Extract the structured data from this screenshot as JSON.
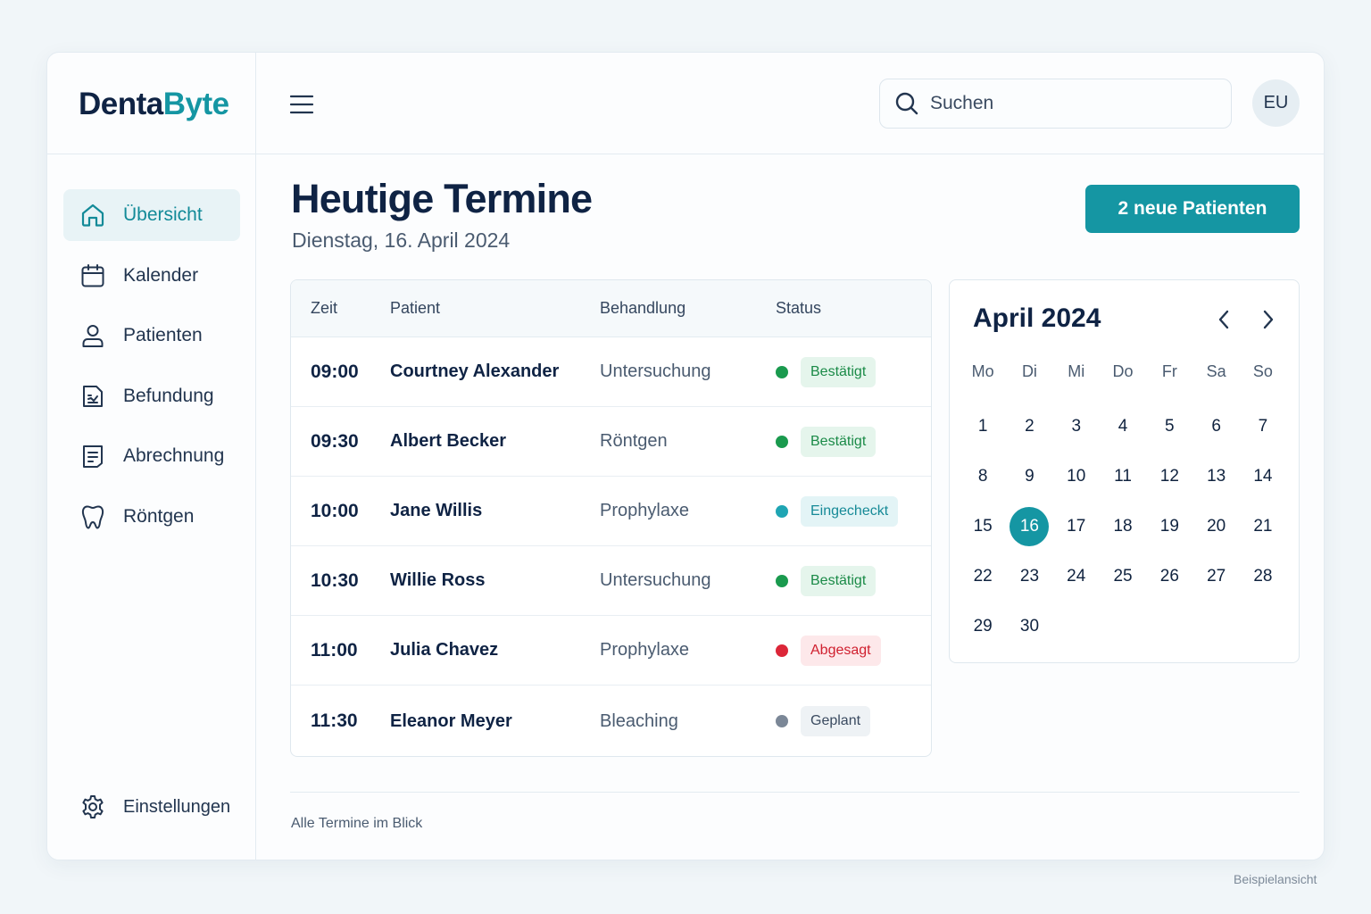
{
  "brand": {
    "part1": "Denta",
    "part2": "Byte"
  },
  "header": {
    "search_placeholder": "Suchen",
    "avatar_initials": "EU"
  },
  "sidebar": {
    "items": [
      {
        "label": "Übersicht",
        "icon": "home-icon",
        "active": true
      },
      {
        "label": "Kalender",
        "icon": "calendar-icon",
        "active": false
      },
      {
        "label": "Patienten",
        "icon": "user-icon",
        "active": false
      },
      {
        "label": "Befundung",
        "icon": "chart-file-icon",
        "active": false
      },
      {
        "label": "Abrechnung",
        "icon": "invoice-icon",
        "active": false
      },
      {
        "label": "Röntgen",
        "icon": "tooth-icon",
        "active": false
      }
    ],
    "settings_label": "Einstellungen"
  },
  "main": {
    "title": "Heutige Termine",
    "date": "Dienstag, 16. April 2024",
    "new_patients_button": "2 neue Patienten",
    "table": {
      "headers": [
        "Zeit",
        "Patient",
        "Behandlung",
        "Status"
      ],
      "rows": [
        {
          "time": "09:00",
          "patient": "Courtney Alexander",
          "treatment": "Untersuchung",
          "status": "Bestätigt"
        },
        {
          "time": "09:30",
          "patient": "Albert Becker",
          "treatment": "Röntgen",
          "status": "Bestätigt"
        },
        {
          "time": "10:00",
          "patient": "Jane Willis",
          "treatment": "Prophylaxe",
          "status": "Eingecheckt"
        },
        {
          "time": "10:30",
          "patient": "Willie Ross",
          "treatment": "Untersuchung",
          "status": "Bestätigt"
        },
        {
          "time": "11:00",
          "patient": "Julia Chavez",
          "treatment": "Prophylaxe",
          "status": "Abgesagt"
        },
        {
          "time": "11:30",
          "patient": "Eleanor Meyer",
          "treatment": "Bleaching",
          "status": "Geplant"
        }
      ]
    },
    "status_colors": {
      "Bestätigt": {
        "dot": "#1a9a4e",
        "bg": "#e5f5ec",
        "text": "#1a8a47"
      },
      "Eingecheckt": {
        "dot": "#1fa5b3",
        "bg": "#e3f4f6",
        "text": "#168a97"
      },
      "Abgesagt": {
        "dot": "#dc2638",
        "bg": "#fde8ea",
        "text": "#d0202f"
      },
      "Geplant": {
        "dot": "#7b8797",
        "bg": "#eef2f5",
        "text": "#3a4a60"
      }
    },
    "footer_text": "Alle Termine im Blick"
  },
  "calendar": {
    "title": "April 2024",
    "weekdays": [
      "Mo",
      "Di",
      "Mi",
      "Do",
      "Fr",
      "Sa",
      "So"
    ],
    "weeks": [
      [
        "1",
        "2",
        "3",
        "4",
        "5",
        "6",
        "7"
      ],
      [
        "8",
        "9",
        "10",
        "11",
        "12",
        "13",
        "14"
      ],
      [
        "15",
        "16",
        "17",
        "18",
        "19",
        "20",
        "21"
      ],
      [
        "22",
        "23",
        "24",
        "25",
        "26",
        "27",
        "28"
      ],
      [
        "29",
        "30",
        "",
        "",
        "",
        "",
        ""
      ]
    ],
    "selected": "16"
  },
  "colors": {
    "accent": "#1596a3",
    "navy": "#0f2344"
  },
  "watermark": "Beispielansicht"
}
